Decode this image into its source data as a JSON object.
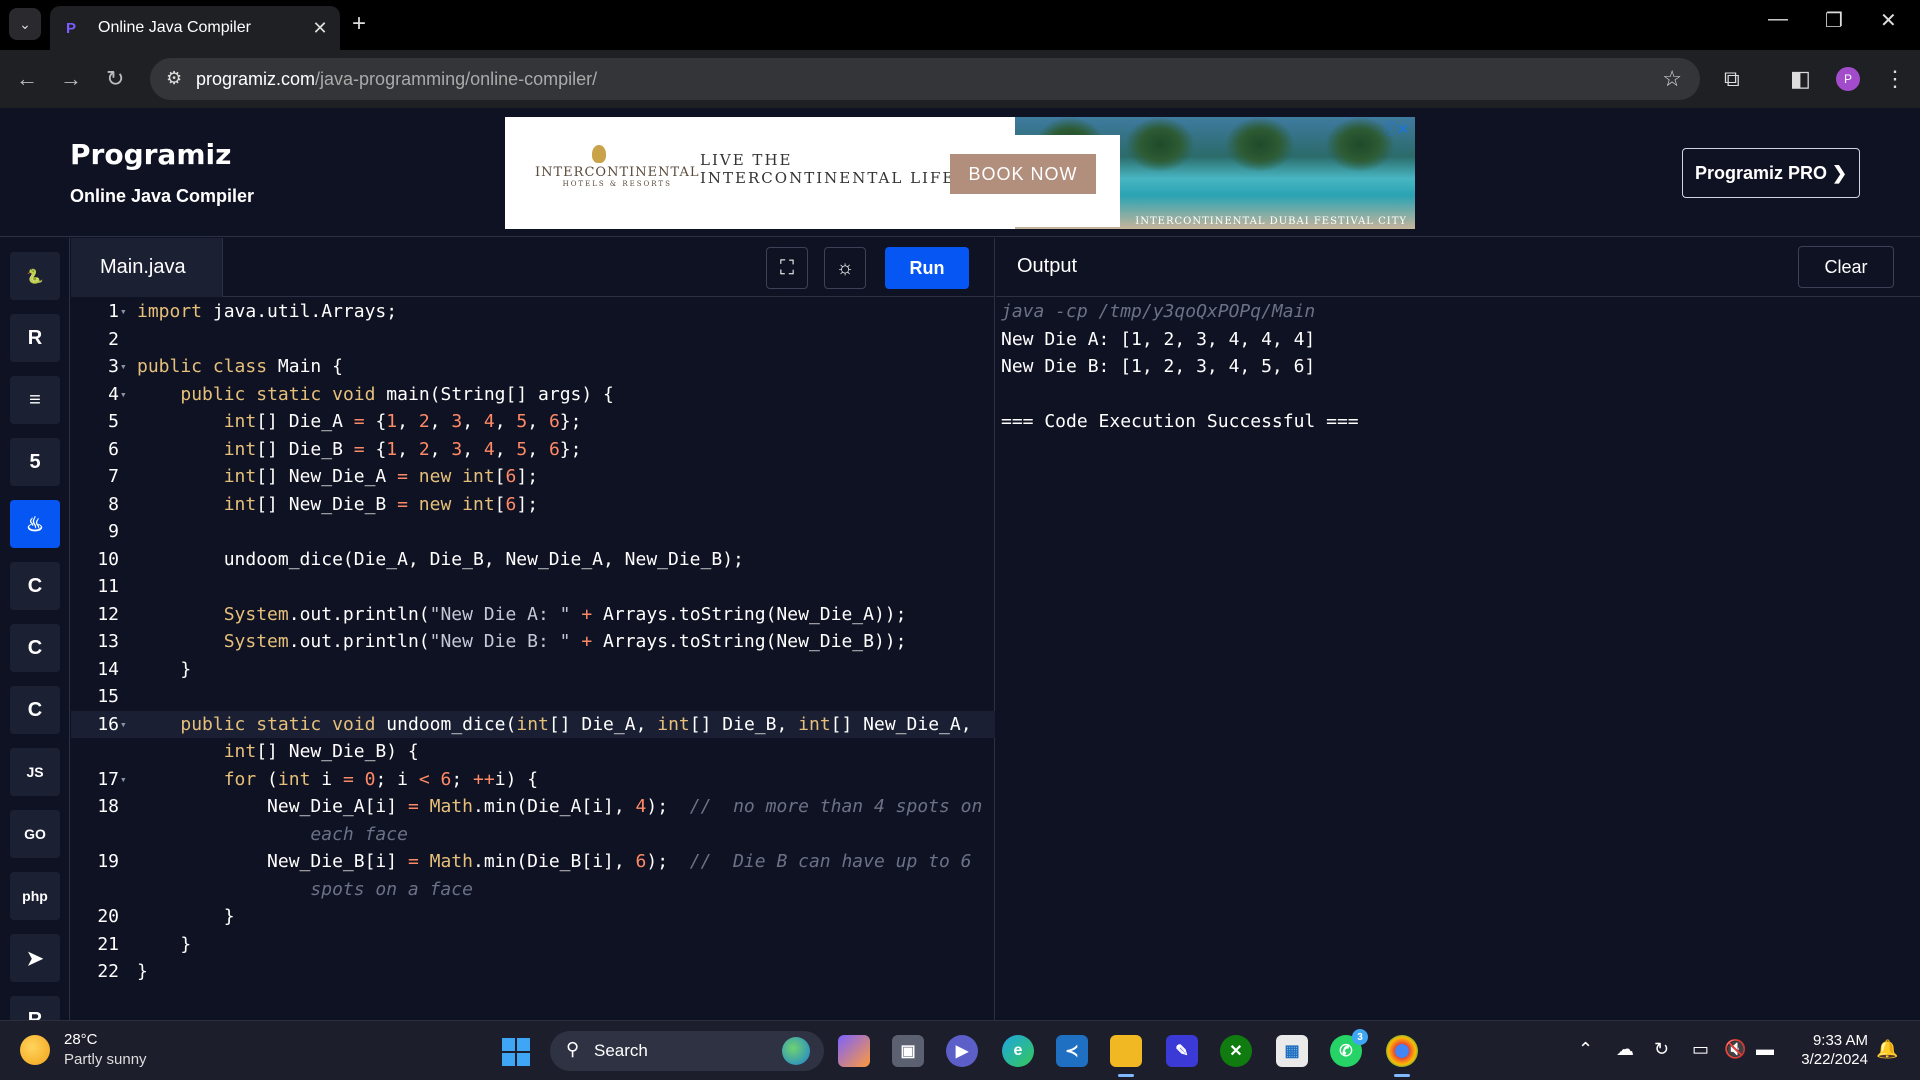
{
  "browser": {
    "tab_title": "Online Java Compiler",
    "url_host": "programiz.com",
    "url_path": "/java-programming/online-compiler/",
    "profile_initial": "P"
  },
  "site": {
    "logo": "Programiz",
    "subtitle": "Online Java Compiler",
    "pro_button": "Programiz PRO ❯"
  },
  "ad": {
    "brand": "INTERCONTINENTAL",
    "brand_sub": "HOTELS & RESORTS",
    "tagline_1": "LIVE THE",
    "tagline_2": "INTERCONTINENTAL LIFE",
    "cta": "BOOK NOW",
    "caption": "INTERCONTINENTAL DUBAI FESTIVAL CITY"
  },
  "sidebar": {
    "items": [
      {
        "icon": "python-icon",
        "glyph": "🐍"
      },
      {
        "icon": "r-icon",
        "glyph": "R"
      },
      {
        "icon": "sql-icon",
        "glyph": "≡"
      },
      {
        "icon": "html-icon",
        "glyph": "5"
      },
      {
        "icon": "java-icon",
        "glyph": "♨",
        "active": true
      },
      {
        "icon": "c-icon",
        "glyph": "C"
      },
      {
        "icon": "cpp-icon",
        "glyph": "C"
      },
      {
        "icon": "csharp-icon",
        "glyph": "C"
      },
      {
        "icon": "js-icon",
        "glyph": "JS"
      },
      {
        "icon": "go-icon",
        "glyph": "GO"
      },
      {
        "icon": "php-icon",
        "glyph": "php"
      },
      {
        "icon": "swift-icon",
        "glyph": "➤"
      },
      {
        "icon": "rust-icon",
        "glyph": "R"
      }
    ]
  },
  "editor": {
    "file_tab": "Main.java",
    "run_label": "Run",
    "lines": [
      {
        "n": "1",
        "fold": true,
        "html": "<span class=\"kw\">import</span> java.util.Arrays;"
      },
      {
        "n": "2",
        "html": ""
      },
      {
        "n": "3",
        "fold": true,
        "html": "<span class=\"kw\">public</span> <span class=\"kw\">class</span> Main {"
      },
      {
        "n": "4",
        "fold": true,
        "html": "    <span class=\"kw\">public</span> <span class=\"kw\">static</span> <span class=\"kw\">void</span> main(String[] args) {"
      },
      {
        "n": "5",
        "html": "        <span class=\"kt\">int</span>[] Die_A <span class=\"op\">=</span> {<span class=\"num\">1</span>, <span class=\"num\">2</span>, <span class=\"num\">3</span>, <span class=\"num\">4</span>, <span class=\"num\">5</span>, <span class=\"num\">6</span>};"
      },
      {
        "n": "6",
        "html": "        <span class=\"kt\">int</span>[] Die_B <span class=\"op\">=</span> {<span class=\"num\">1</span>, <span class=\"num\">2</span>, <span class=\"num\">3</span>, <span class=\"num\">4</span>, <span class=\"num\">5</span>, <span class=\"num\">6</span>};"
      },
      {
        "n": "7",
        "html": "        <span class=\"kt\">int</span>[] New_Die_A <span class=\"op\">=</span> <span class=\"kw\">new</span> <span class=\"kt\">int</span>[<span class=\"num\">6</span>];"
      },
      {
        "n": "8",
        "html": "        <span class=\"kt\">int</span>[] New_Die_B <span class=\"op\">=</span> <span class=\"kw\">new</span> <span class=\"kt\">int</span>[<span class=\"num\">6</span>];"
      },
      {
        "n": "9",
        "html": ""
      },
      {
        "n": "10",
        "html": "        undoom_dice(Die_A, Die_B, New_Die_A, New_Die_B);"
      },
      {
        "n": "11",
        "html": ""
      },
      {
        "n": "12",
        "html": "        <span class=\"kw\">System</span>.out.println(<span class=\"str\">\"New Die A: \"</span> <span class=\"op\">+</span> Arrays.toString(New_Die_A));"
      },
      {
        "n": "13",
        "html": "        <span class=\"kw\">System</span>.out.println(<span class=\"str\">\"New Die B: \"</span> <span class=\"op\">+</span> Arrays.toString(New_Die_B));"
      },
      {
        "n": "14",
        "html": "    }"
      },
      {
        "n": "15",
        "html": ""
      },
      {
        "n": "16",
        "fold": true,
        "current": true,
        "html": "    <span class=\"kw\">public</span> <span class=\"kw\">static</span> <span class=\"kw\">void</span> undoom_dice(<span class=\"kt\">int</span>[] Die_A, <span class=\"kt\">int</span>[] Die_B, <span class=\"kt\">int</span>[] New_Die_A,"
      },
      {
        "n": "",
        "html": "        <span class=\"kt\">int</span>[] New_Die_B) {"
      },
      {
        "n": "17",
        "fold": true,
        "html": "        <span class=\"kw\">for</span> (<span class=\"kt\">int</span> i <span class=\"op\">=</span> <span class=\"num\">0</span>; i <span class=\"op\">&lt;</span> <span class=\"num\">6</span>; <span class=\"op\">++</span>i) {"
      },
      {
        "n": "18",
        "html": "            New_Die_A[i] <span class=\"op\">=</span> <span class=\"kw\">Math</span>.min(Die_A[i], <span class=\"num\">4</span>);  <span class=\"cm\">//  no more than 4 spots on</span>"
      },
      {
        "n": "",
        "html": "                <span class=\"cm\">each face</span>"
      },
      {
        "n": "19",
        "html": "            New_Die_B[i] <span class=\"op\">=</span> <span class=\"kw\">Math</span>.min(Die_B[i], <span class=\"num\">6</span>);  <span class=\"cm\">//  Die B can have up to 6</span>"
      },
      {
        "n": "",
        "html": "                <span class=\"cm\">spots on a face</span>"
      },
      {
        "n": "20",
        "html": "        }"
      },
      {
        "n": "21",
        "html": "    }"
      },
      {
        "n": "22",
        "html": "}"
      }
    ]
  },
  "output": {
    "title": "Output",
    "clear_label": "Clear",
    "lines": [
      {
        "text": "java -cp /tmp/y3qoQxPOPq/Main",
        "cmd": true
      },
      {
        "text": "New Die A: [1, 2, 3, 4, 4, 4]"
      },
      {
        "text": "New Die B: [1, 2, 3, 4, 5, 6]"
      },
      {
        "text": ""
      },
      {
        "text": "=== Code Execution Successful ==="
      }
    ]
  },
  "taskbar": {
    "temperature": "28°C",
    "condition": "Partly sunny",
    "search_label": "Search",
    "time": "9:33 AM",
    "date": "3/22/2024",
    "whatsapp_badge": "3"
  }
}
